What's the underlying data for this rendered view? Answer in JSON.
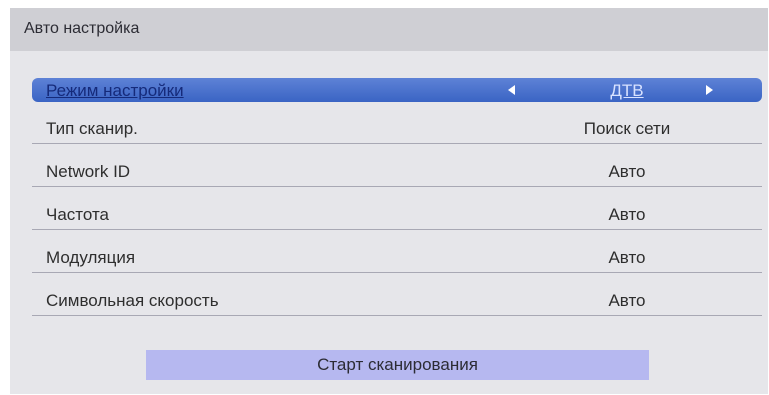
{
  "header": {
    "title": "Авто настройка"
  },
  "settings": [
    {
      "label": "Режим настройки",
      "value": "ДТВ"
    },
    {
      "label": "Тип сканир.",
      "value": "Поиск сети"
    },
    {
      "label": "Network ID",
      "value": "Авто"
    },
    {
      "label": "Частота",
      "value": "Авто"
    },
    {
      "label": "Модуляция",
      "value": "Авто"
    },
    {
      "label": "Символьная скорость",
      "value": "Авто"
    }
  ],
  "start_button": {
    "label": "Старт сканирования"
  },
  "colors": {
    "selection": "#3a64c4",
    "button": "#b6b8f0",
    "panel": "#e6e6ea",
    "header": "#cfcfd4"
  }
}
